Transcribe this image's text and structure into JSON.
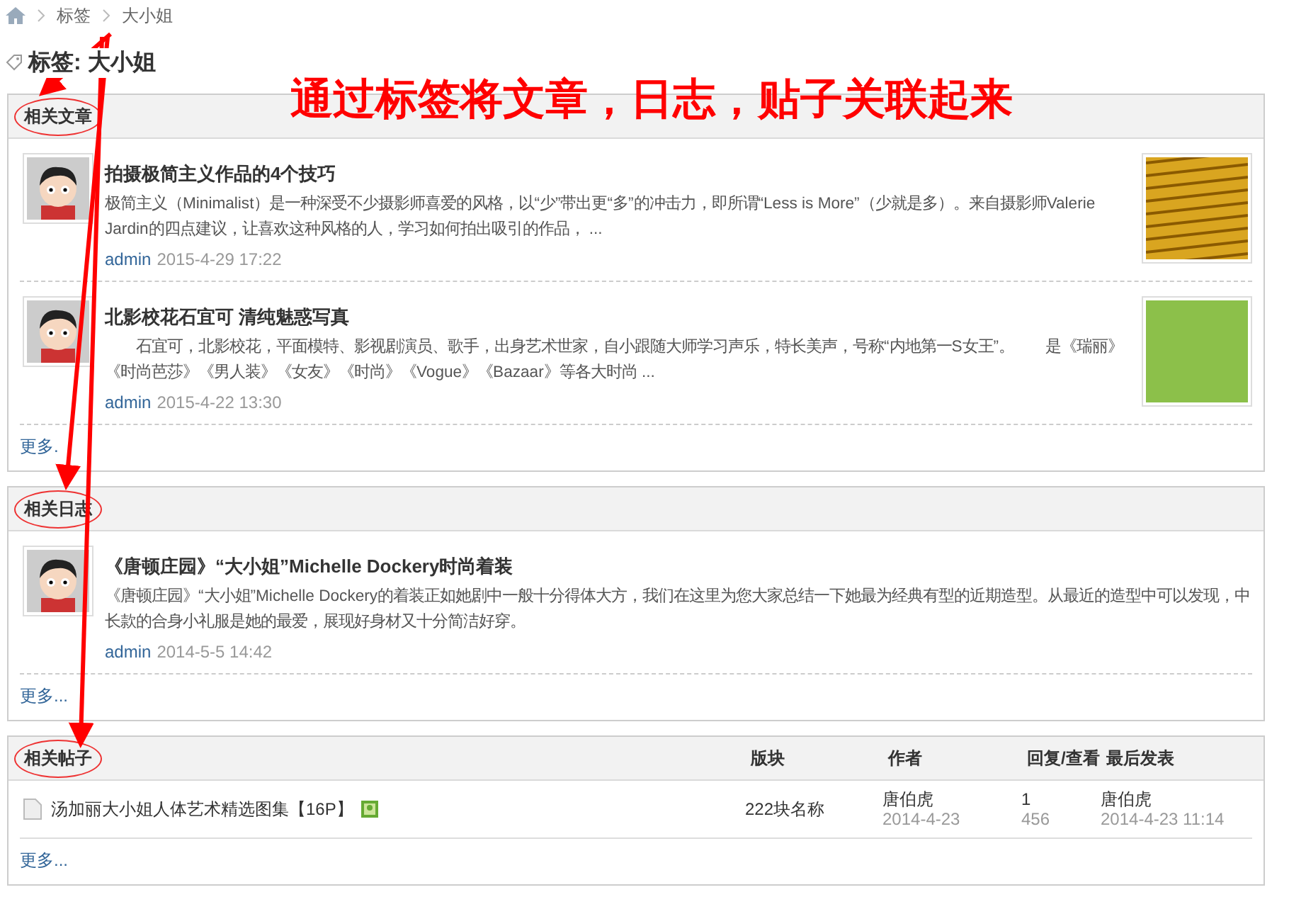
{
  "breadcrumb": [
    "标签",
    "大小姐"
  ],
  "page_title": "标签: 大小姐",
  "annotation": {
    "text": "通过标签将文章，日志，贴子关联起来"
  },
  "sections": [
    {
      "kind": "posts",
      "title": "相关文章",
      "circled": true,
      "items": [
        {
          "title": "拍摄极简主义作品的4个技巧",
          "excerpt": "极简主义（Minimalist）是一种深受不少摄影师喜爱的风格，以“少”带出更“多”的冲击力，即所谓“Less is More”（少就是多）。来自摄影师Valerie Jardin的四点建议，让喜欢这种风格的人，学习如何拍出吸引的作品， ...",
          "author": "admin",
          "date": "2015-4-29 17:22",
          "thumbnail": {
            "kind": "pattern"
          }
        },
        {
          "title": "北影校花石宜可 清纯魅惑写真",
          "excerpt": "　　石宜可，北影校花，平面模特、影视剧演员、歌手，出身艺术世家，自小跟随大师学习声乐，特长美声，号称“内地第一S女王”。　　是《瑞丽》《时尚芭莎》《男人装》《女友》《时尚》《Vogue》《Bazaar》等各大时尚 ...",
          "author": "admin",
          "date": "2015-4-22 13:30",
          "thumbnail": {
            "kind": "photo"
          }
        }
      ],
      "more": "更多."
    },
    {
      "kind": "posts",
      "title": "相关日志",
      "circled": true,
      "items": [
        {
          "title": "《唐顿庄园》“大小姐”Michelle Dockery时尚着装",
          "excerpt": "《唐顿庄园》“大小姐”Michelle Dockery的着装正如她剧中一般十分得体大方，我们在这里为您大家总结一下她最为经典有型的近期造型。从最近的造型中可以发现，中长款的合身小礼服是她的最爱，展现好身材又十分简洁好穿。",
          "author": "admin",
          "date": "2014-5-5 14:42"
        }
      ],
      "more": "更多..."
    },
    {
      "kind": "threads",
      "title": "相关帖子",
      "circled": true,
      "columns": [
        "版块",
        "作者",
        "回复/查看",
        "最后发表"
      ],
      "rows": [
        {
          "title": "汤加丽大小姐人体艺术精选图集【16P】",
          "has_image": true,
          "forum": "222块名称",
          "author": "唐伯虎",
          "date": "2014-4-23",
          "replies": "1",
          "views": "456",
          "last_poster": "唐伯虎",
          "last_time": "2014-4-23 11:14"
        }
      ],
      "more": "更多..."
    }
  ]
}
